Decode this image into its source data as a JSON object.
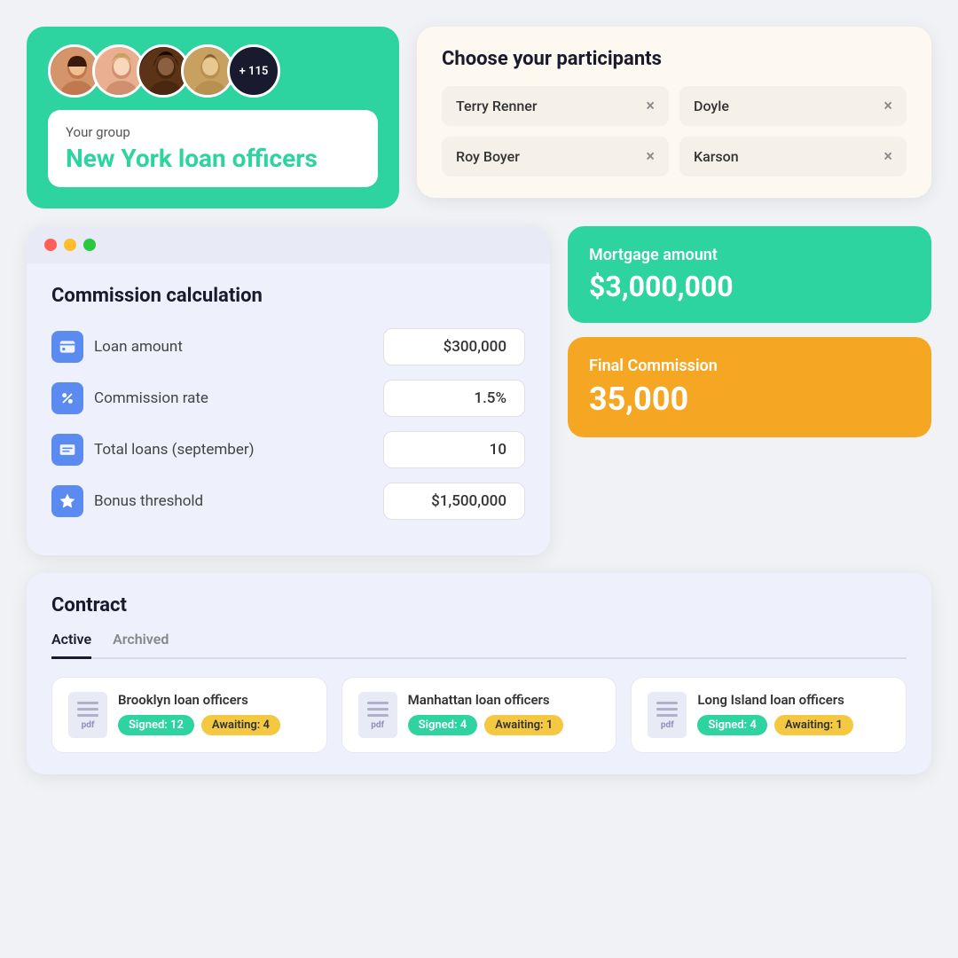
{
  "group": {
    "label": "Your group",
    "name": "New York loan officers",
    "avatar_count": "+ 115"
  },
  "participants": {
    "title": "Choose your participants",
    "items": [
      {
        "name": "Terry Renner"
      },
      {
        "name": "Doyle"
      },
      {
        "name": "Roy Boyer"
      },
      {
        "name": "Karson"
      }
    ]
  },
  "calculator": {
    "title": "Commission calculation",
    "rows": [
      {
        "label": "Loan amount",
        "value": "$300,000",
        "icon": "💳"
      },
      {
        "label": "Commission rate",
        "value": "1.5%",
        "icon": "%"
      },
      {
        "label": "Total loans (september)",
        "value": "10",
        "icon": "🪪"
      },
      {
        "label": "Bonus threshold",
        "value": "$1,500,000",
        "icon": "⭐"
      }
    ]
  },
  "mortgage": {
    "label": "Mortgage amount",
    "amount": "$3,000,000"
  },
  "final_commission": {
    "label": "Final Commission",
    "amount": "35,000"
  },
  "contract": {
    "title": "Contract",
    "tabs": [
      "Active",
      "Archived"
    ],
    "active_tab": "Active",
    "items": [
      {
        "name": "Brooklyn loan officers",
        "signed_label": "Signed: 12",
        "awaiting_label": "Awaiting: 4"
      },
      {
        "name": "Manhattan loan officers",
        "signed_label": "Signed: 4",
        "awaiting_label": "Awaiting: 1"
      },
      {
        "name": "Long Island loan officers",
        "signed_label": "Signed: 4",
        "awaiting_label": "Awaiting: 1"
      }
    ]
  },
  "icons": {
    "remove": "×",
    "pdf": "pdf"
  }
}
